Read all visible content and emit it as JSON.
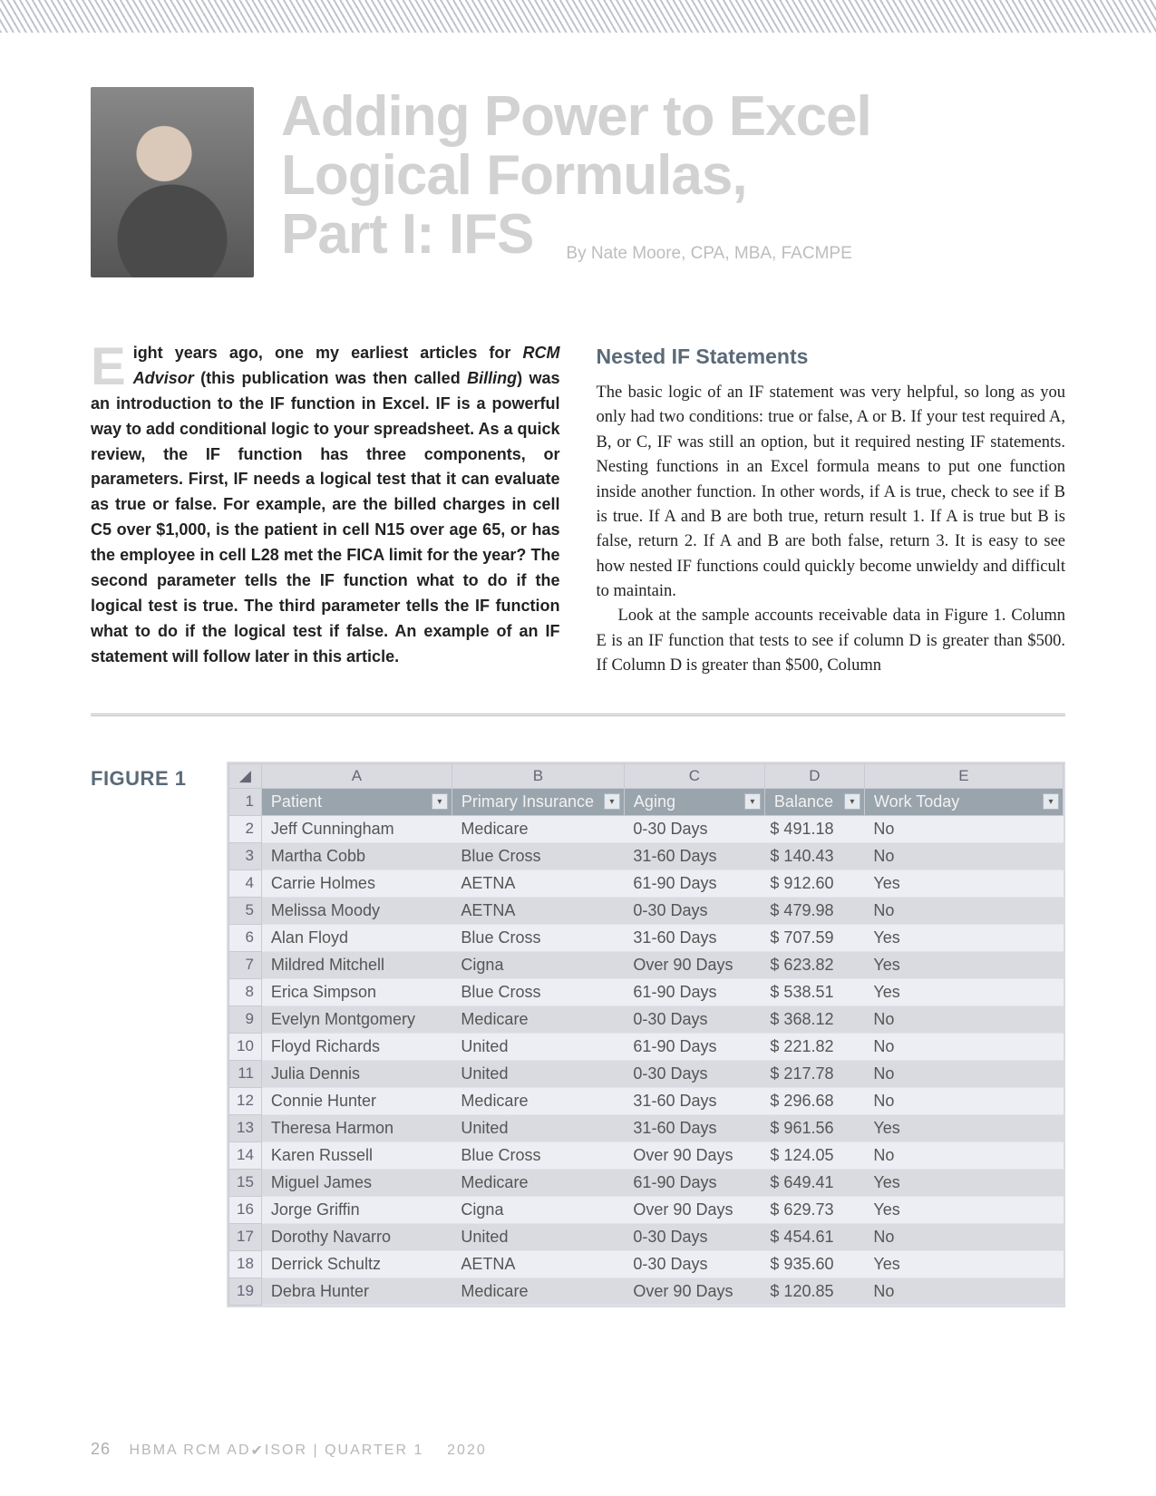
{
  "article": {
    "title_l1": "Adding Power to Excel",
    "title_l2": "Logical Formulas,",
    "title_l3": "Part I: IFS",
    "byline": "By Nate Moore, CPA, MBA, FACMPE",
    "dropcap": "E",
    "intro_rest": "ight years ago, one my earliest articles for ",
    "intro_em1": "RCM Advisor",
    "intro_mid": " (this publication was then called ",
    "intro_em2": "Billing",
    "intro_tail": ") was an introduction to the IF function in Excel. IF is a powerful way to add conditional logic to your spreadsheet. As a quick review, the IF function has three components, or parameters. First, IF needs a logical test that it can evaluate as true or false. For example, are the billed charges in cell C5 over $1,000, is the patient in cell N15 over age 65, or has the employee in cell L28 met the FICA limit for the year? The second parameter tells the IF function what to do if the logical test is true. The third parameter tells the IF function what to do if the logical test if false. An example of an IF statement will follow later in this article.",
    "subhead": "Nested IF Statements",
    "col2_p1": "The basic logic of an IF statement was very helpful, so long as you only had two conditions: true or false, A or B. If your test required A, B, or C, IF was still an option, but it required nesting IF statements. Nesting functions in an Excel formula means to put one function inside another function. In other words, if A is true, check to see if B is true. If A and B are both true, return result 1. If A is true but B is false, return 2. If A and B are both false, return 3. It is easy to see how nested IF functions could quickly become unwieldy and difficult to maintain.",
    "col2_p2": "Look at the sample accounts receivable data in Figure 1. Column E is an IF function that tests to see if column D is greater than $500. If Column D is greater than $500, Column"
  },
  "figure": {
    "label": "FIGURE 1",
    "col_letters": [
      "A",
      "B",
      "C",
      "D",
      "E"
    ],
    "headers": [
      "Patient",
      "Primary Insurance",
      "Aging",
      "Balance",
      "Work Today"
    ],
    "rows": [
      {
        "n": "2",
        "patient": "Jeff Cunningham",
        "ins": "Medicare",
        "aging": "0-30 Days",
        "bal": "$  491.18",
        "work": "No"
      },
      {
        "n": "3",
        "patient": "Martha Cobb",
        "ins": "Blue Cross",
        "aging": "31-60 Days",
        "bal": "$  140.43",
        "work": "No"
      },
      {
        "n": "4",
        "patient": "Carrie Holmes",
        "ins": "AETNA",
        "aging": "61-90 Days",
        "bal": "$  912.60",
        "work": "Yes"
      },
      {
        "n": "5",
        "patient": "Melissa Moody",
        "ins": "AETNA",
        "aging": "0-30 Days",
        "bal": "$  479.98",
        "work": "No"
      },
      {
        "n": "6",
        "patient": "Alan Floyd",
        "ins": "Blue Cross",
        "aging": "31-60 Days",
        "bal": "$  707.59",
        "work": "Yes"
      },
      {
        "n": "7",
        "patient": "Mildred Mitchell",
        "ins": "Cigna",
        "aging": "Over 90 Days",
        "bal": "$  623.82",
        "work": "Yes"
      },
      {
        "n": "8",
        "patient": "Erica Simpson",
        "ins": "Blue Cross",
        "aging": "61-90 Days",
        "bal": "$  538.51",
        "work": "Yes"
      },
      {
        "n": "9",
        "patient": "Evelyn Montgomery",
        "ins": "Medicare",
        "aging": "0-30 Days",
        "bal": "$  368.12",
        "work": "No"
      },
      {
        "n": "10",
        "patient": "Floyd Richards",
        "ins": "United",
        "aging": "61-90 Days",
        "bal": "$  221.82",
        "work": "No"
      },
      {
        "n": "11",
        "patient": "Julia Dennis",
        "ins": "United",
        "aging": "0-30 Days",
        "bal": "$  217.78",
        "work": "No"
      },
      {
        "n": "12",
        "patient": "Connie Hunter",
        "ins": "Medicare",
        "aging": "31-60 Days",
        "bal": "$  296.68",
        "work": "No"
      },
      {
        "n": "13",
        "patient": "Theresa Harmon",
        "ins": "United",
        "aging": "31-60 Days",
        "bal": "$  961.56",
        "work": "Yes"
      },
      {
        "n": "14",
        "patient": "Karen Russell",
        "ins": "Blue Cross",
        "aging": "Over 90 Days",
        "bal": "$  124.05",
        "work": "No"
      },
      {
        "n": "15",
        "patient": "Miguel James",
        "ins": "Medicare",
        "aging": "61-90 Days",
        "bal": "$  649.41",
        "work": "Yes"
      },
      {
        "n": "16",
        "patient": "Jorge Griffin",
        "ins": "Cigna",
        "aging": "Over 90 Days",
        "bal": "$  629.73",
        "work": "Yes"
      },
      {
        "n": "17",
        "patient": "Dorothy Navarro",
        "ins": "United",
        "aging": "0-30 Days",
        "bal": "$  454.61",
        "work": "No"
      },
      {
        "n": "18",
        "patient": "Derrick Schultz",
        "ins": "AETNA",
        "aging": "0-30 Days",
        "bal": "$  935.60",
        "work": "Yes"
      },
      {
        "n": "19",
        "patient": "Debra Hunter",
        "ins": "Medicare",
        "aging": "Over 90 Days",
        "bal": "$  120.85",
        "work": "No"
      }
    ]
  },
  "footer": {
    "page": "26",
    "pub": "HBMA RCM AD",
    "pub2": "ISOR",
    "sep": "  |  ",
    "quarter": "QUARTER 1",
    "year": "2020"
  },
  "glyphs": {
    "filter_arrow": "▾",
    "select_all": "◢"
  }
}
